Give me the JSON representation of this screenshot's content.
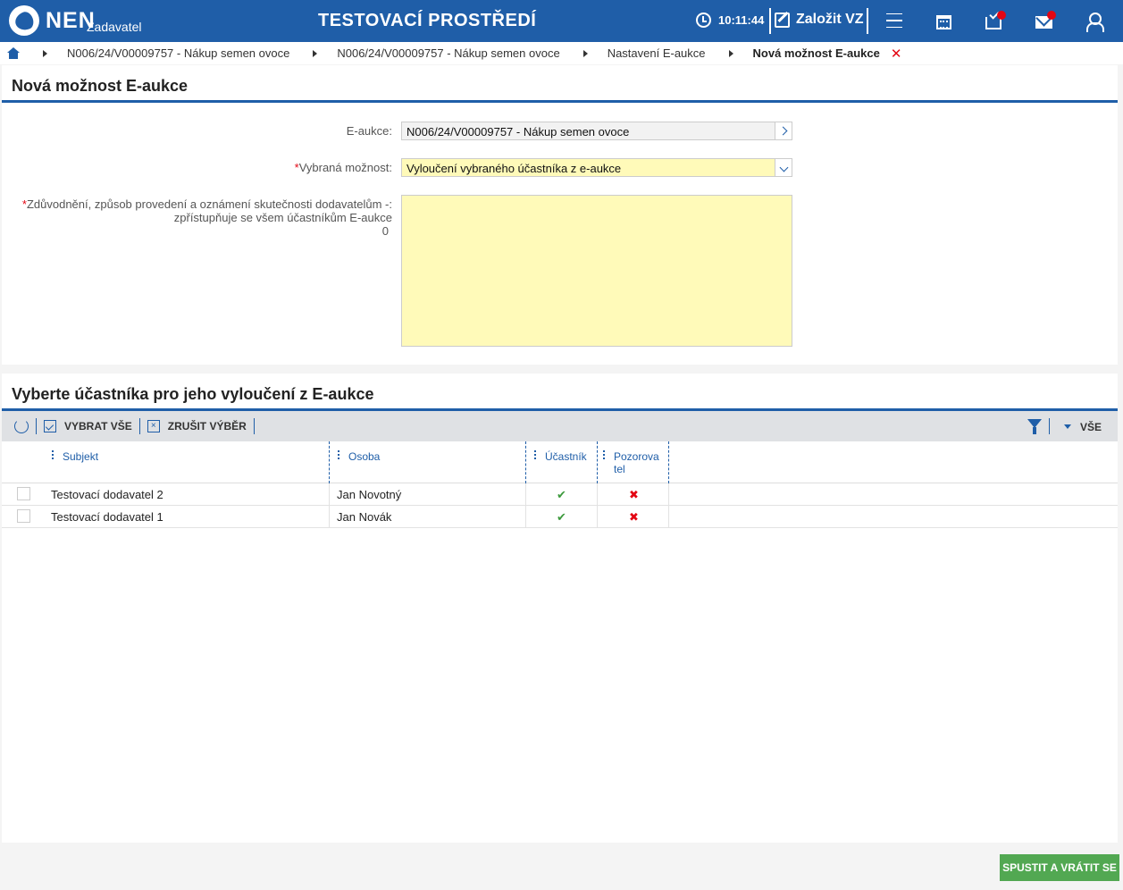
{
  "topbar": {
    "brand": "NEN",
    "brand_sub": "Zadavatel",
    "environment": "TESTOVACÍ PROSTŘEDÍ",
    "time": "10:11:44",
    "create_label": "Založit VZ"
  },
  "breadcrumb": {
    "items": [
      "N006/24/V00009757 - Nákup semen ovoce",
      "N006/24/V00009757 - Nákup semen ovoce",
      "Nastavení E-aukce",
      "Nová možnost E-aukce"
    ]
  },
  "form": {
    "title": "Nová možnost E-aukce",
    "eaukce_label": "E-aukce:",
    "eaukce_value": "N006/24/V00009757 - Nákup semen ovoce",
    "option_label": "Vybraná možnost:",
    "option_value": "Vyloučení vybraného účastníka z e-aukce",
    "reason_label_1": "Zdůvodnění, způsob provedení a oznámení skutečnosti dodavatelům -:",
    "reason_label_2": "zpřístupňuje se všem účastníkům E-aukce",
    "reason_count": "0",
    "reason_value": ""
  },
  "participants": {
    "title": "Vyberte účastníka pro jeho vyloučení z E-aukce",
    "toolbar": {
      "select_all": "VYBRAT VŠE",
      "clear_selection": "ZRUŠIT VÝBĚR",
      "filter_value": "VŠE"
    },
    "columns": {
      "subject": "Subjekt",
      "person": "Osoba",
      "participant": "Účastník",
      "observer_1": "Pozorova",
      "observer_2": "tel"
    },
    "rows": [
      {
        "subject": "Testovací dodavatel 2",
        "person": "Jan Novotný",
        "participant": "✔",
        "observer": "✖"
      },
      {
        "subject": "Testovací dodavatel 1",
        "person": "Jan Novák",
        "participant": "✔",
        "observer": "✖"
      }
    ]
  },
  "footer": {
    "submit_label": "SPUSTIT A VRÁTIT SE"
  },
  "colors": {
    "brand": "#1f5ea8",
    "required": "#e30613",
    "success": "#52a852",
    "field_highlight": "#fffab9"
  }
}
